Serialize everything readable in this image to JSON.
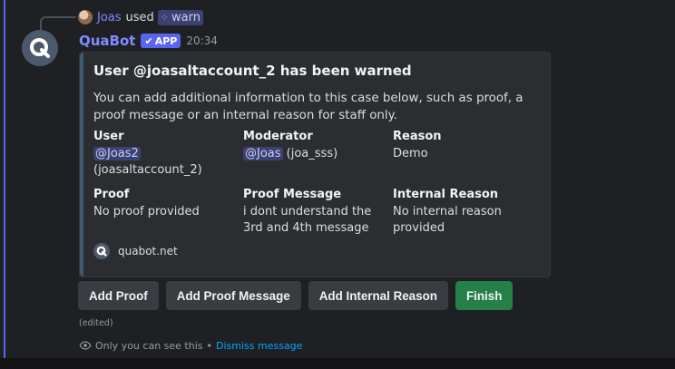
{
  "reply": {
    "user": "Joas",
    "used_text": "used",
    "command": "warn"
  },
  "message": {
    "bot_name": "QuaBot",
    "badge": "APP",
    "timestamp": "20:34"
  },
  "embed": {
    "title": "User @joasaltaccount_2 has been warned",
    "description": "You can add additional information to this case below, such as proof, a proof message or an internal reason for staff only.",
    "fields": {
      "user": {
        "name": "User",
        "mention": "@Joas2",
        "extra": "(joasaltaccount_2)"
      },
      "moderator": {
        "name": "Moderator",
        "mention": "@Joas",
        "extra": "(joa_sss)"
      },
      "reason": {
        "name": "Reason",
        "value": "Demo"
      },
      "proof": {
        "name": "Proof",
        "value": "No proof provided"
      },
      "proof_message": {
        "name": "Proof Message",
        "value": "i dont understand the 3rd and 4th message"
      },
      "internal_reason": {
        "name": "Internal Reason",
        "value": "No internal reason provided"
      }
    },
    "footer": "quabot.net",
    "accent_color": "#3f5a6e"
  },
  "buttons": {
    "add_proof": "Add Proof",
    "add_proof_message": "Add Proof Message",
    "add_internal_reason": "Add Internal Reason",
    "finish": "Finish"
  },
  "status": {
    "edited": "(edited)",
    "ephemeral_note": "Only you can see this",
    "separator": "•",
    "dismiss": "Dismiss message"
  },
  "colors": {
    "brand": "#5865f2",
    "success": "#248046",
    "link": "#00a8fc"
  },
  "icons": {
    "command": "grid-icon",
    "verified": "checkmark-icon",
    "bot_avatar": "quabot-logo-icon",
    "ephemeral": "eye-icon"
  }
}
